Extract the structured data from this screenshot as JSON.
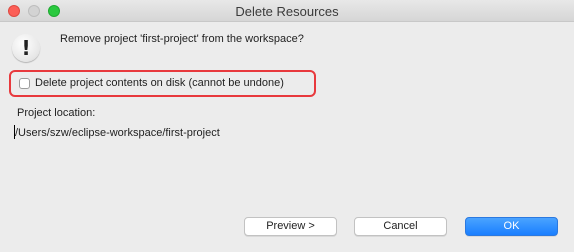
{
  "window": {
    "title": "Delete Resources"
  },
  "dialog": {
    "icon": "warning-icon",
    "icon_glyph": "!",
    "message": "Remove project 'first-project' from the workspace?",
    "delete_contents": {
      "label": "Delete project contents on disk (cannot be undone)",
      "checked": false
    },
    "location_label": "Project location:",
    "location_value": "/Users/szw/eclipse-workspace/first-project"
  },
  "buttons": {
    "preview": "Preview >",
    "cancel": "Cancel",
    "ok": "OK"
  },
  "colors": {
    "highlight_border": "#e8393d",
    "ok_button": "#1a7fff",
    "close_button": "#fc5f57",
    "maximize_button": "#2ac93f"
  }
}
